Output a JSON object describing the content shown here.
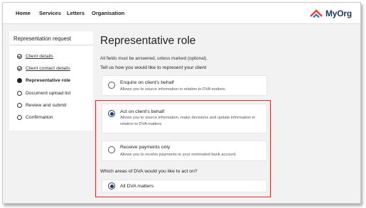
{
  "nav": {
    "items": [
      "Home",
      "Services",
      "Letters",
      "Organisation"
    ],
    "logo_text": "MyOrg",
    "logo_icon": "myorg-chevron-logo"
  },
  "sidebar": {
    "title": "Representation request",
    "steps": [
      {
        "label": "Client details",
        "status": "complete"
      },
      {
        "label": "Client contact details",
        "status": "complete"
      },
      {
        "label": "Representative role",
        "status": "current"
      },
      {
        "label": "Document upload list",
        "status": "todo"
      },
      {
        "label": "Review and submit",
        "status": "todo"
      },
      {
        "label": "Confirmation",
        "status": "todo"
      }
    ]
  },
  "main": {
    "title": "Representative role",
    "hint": "All fields must be answered, unless marked (optional).",
    "question": "Tell us how you would like to represent your client",
    "options": [
      {
        "title": "Enquire on client's behalf",
        "desc": "Allows you to source information in relation to DVA matters.",
        "selected": false
      },
      {
        "title": "Act on client's behalf",
        "desc": "Allows you to source information, make decisions and update information in relation to DVA matters.",
        "selected": true
      },
      {
        "title": "Receive payments only",
        "desc": "Allows you to receive payments to your nominated bank account.",
        "selected": false
      }
    ],
    "sub_question": "Which areas of DVA would you like to act on?",
    "sub_options": [
      {
        "title": "All DVA matters",
        "selected": true
      }
    ]
  },
  "colors": {
    "accent": "#1f3864",
    "highlight": "#d32f2f",
    "logo_red": "#e8463f",
    "logo_blue": "#2e75b6"
  }
}
